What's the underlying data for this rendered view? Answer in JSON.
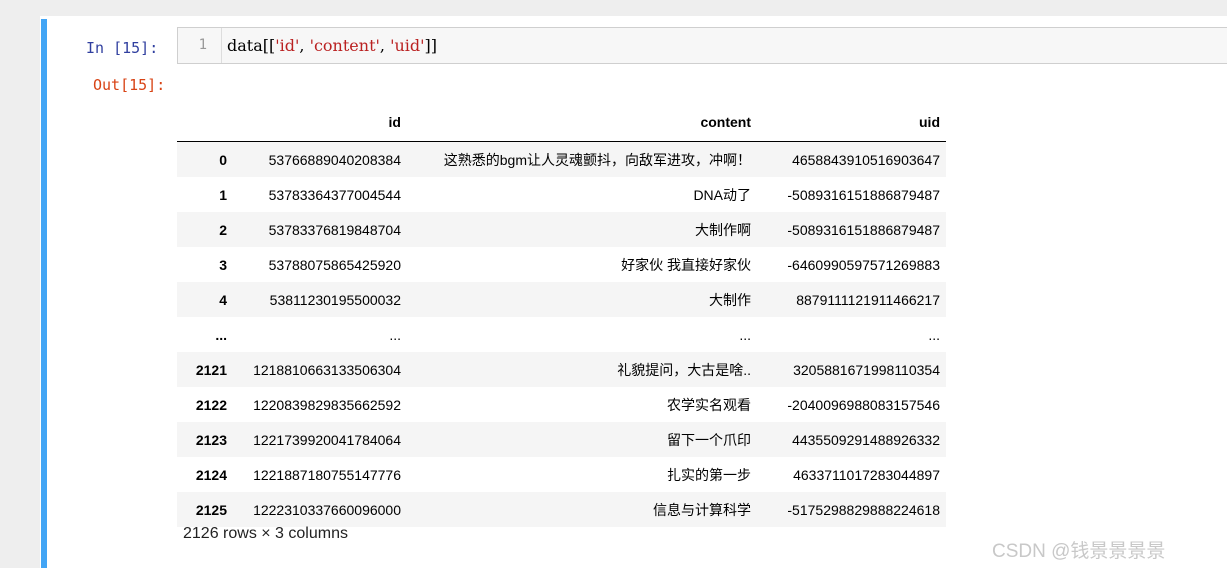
{
  "cell": {
    "in_prompt": "In  [15]:",
    "out_prompt": "Out[15]:",
    "line_number": "1",
    "code_prefix": "data[[",
    "code_str1": "'id'",
    "code_sep1": ", ",
    "code_str2": "'content'",
    "code_sep2": ", ",
    "code_str3": "'uid'",
    "code_suffix": "]]"
  },
  "table": {
    "columns": [
      "",
      "id",
      "content",
      "uid"
    ],
    "rows": [
      {
        "index": "0",
        "id": "53766889040208384",
        "content": "这熟悉的bgm让人灵魂颤抖，向敌军进攻，冲啊！",
        "uid": "4658843910516903647"
      },
      {
        "index": "1",
        "id": "53783364377004544",
        "content": "DNA动了",
        "uid": "-5089316151886879487"
      },
      {
        "index": "2",
        "id": "53783376819848704",
        "content": "大制作啊",
        "uid": "-5089316151886879487"
      },
      {
        "index": "3",
        "id": "53788075865425920",
        "content": "好家伙 我直接好家伙",
        "uid": "-6460990597571269883"
      },
      {
        "index": "4",
        "id": "53811230195500032",
        "content": "大制作",
        "uid": "8879111121911466217"
      },
      {
        "index": "...",
        "id": "...",
        "content": "...",
        "uid": "..."
      },
      {
        "index": "2121",
        "id": "1218810663133506304",
        "content": "礼貌提问，大古是啥..",
        "uid": "3205881671998110354"
      },
      {
        "index": "2122",
        "id": "1220839829835662592",
        "content": "农学实名观看",
        "uid": "-2040096988083157546"
      },
      {
        "index": "2123",
        "id": "1221739920041784064",
        "content": "留下一个爪印",
        "uid": "4435509291488926332"
      },
      {
        "index": "2124",
        "id": "1221887180755147776",
        "content": "扎实的第一步",
        "uid": "4633711017283044897"
      },
      {
        "index": "2125",
        "id": "1222310337660096000",
        "content": "信息与计算科学",
        "uid": "-5175298829888224618"
      }
    ],
    "summary": "2126 rows × 3 columns"
  },
  "watermark": "CSDN @钱景景景景",
  "colors": {
    "cell_border": "#42a5f5",
    "in_prompt": "#303f9f",
    "out_prompt": "#d84315",
    "string": "#ba2121"
  }
}
